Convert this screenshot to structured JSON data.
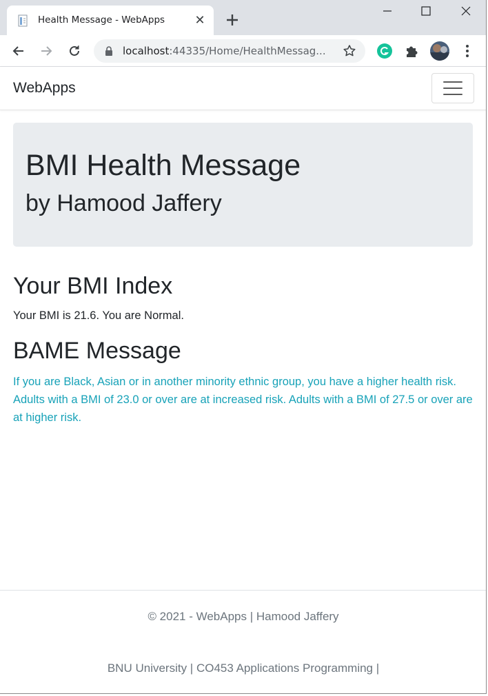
{
  "browser": {
    "tab_title": "Health Message - WebApps",
    "tab_close_glyph": "✕",
    "url_host": "localhost",
    "url_rest": ":44335/Home/HealthMessag...",
    "icons": [
      "page-favicon-icon",
      "close-icon",
      "plus-icon",
      "minimize-icon",
      "maximize-icon",
      "window-close-icon",
      "back-arrow-icon",
      "forward-arrow-icon",
      "reload-icon",
      "lock-icon",
      "star-icon",
      "grammarly-icon",
      "puzzle-icon",
      "profile-avatar-icon",
      "kebab-menu-icon"
    ],
    "colors": {
      "tabstrip": "#dee1e6",
      "omnibox": "#f1f3f4",
      "grammarly": "#15c39a"
    }
  },
  "navbar": {
    "brand": "WebApps",
    "toggler_icon": "hamburger-icon"
  },
  "jumbotron": {
    "title": "BMI Health Message",
    "subtitle": "by Hamood Jaffery"
  },
  "bmi": {
    "heading": "Your BMI Index",
    "text": "Your BMI is 21.6. You are Normal."
  },
  "bame": {
    "heading": "BAME Message",
    "text": "If you are Black, Asian or in another minority ethnic group, you have a higher health risk. Adults with a BMI of 23.0 or over are at increased risk. Adults with a BMI of 27.5 or over are at higher risk.",
    "color": "#17a2b8"
  },
  "footer": {
    "line1": "© 2021 - WebApps | Hamood Jaffery",
    "line2": "BNU University | CO453 Applications Programming |"
  }
}
